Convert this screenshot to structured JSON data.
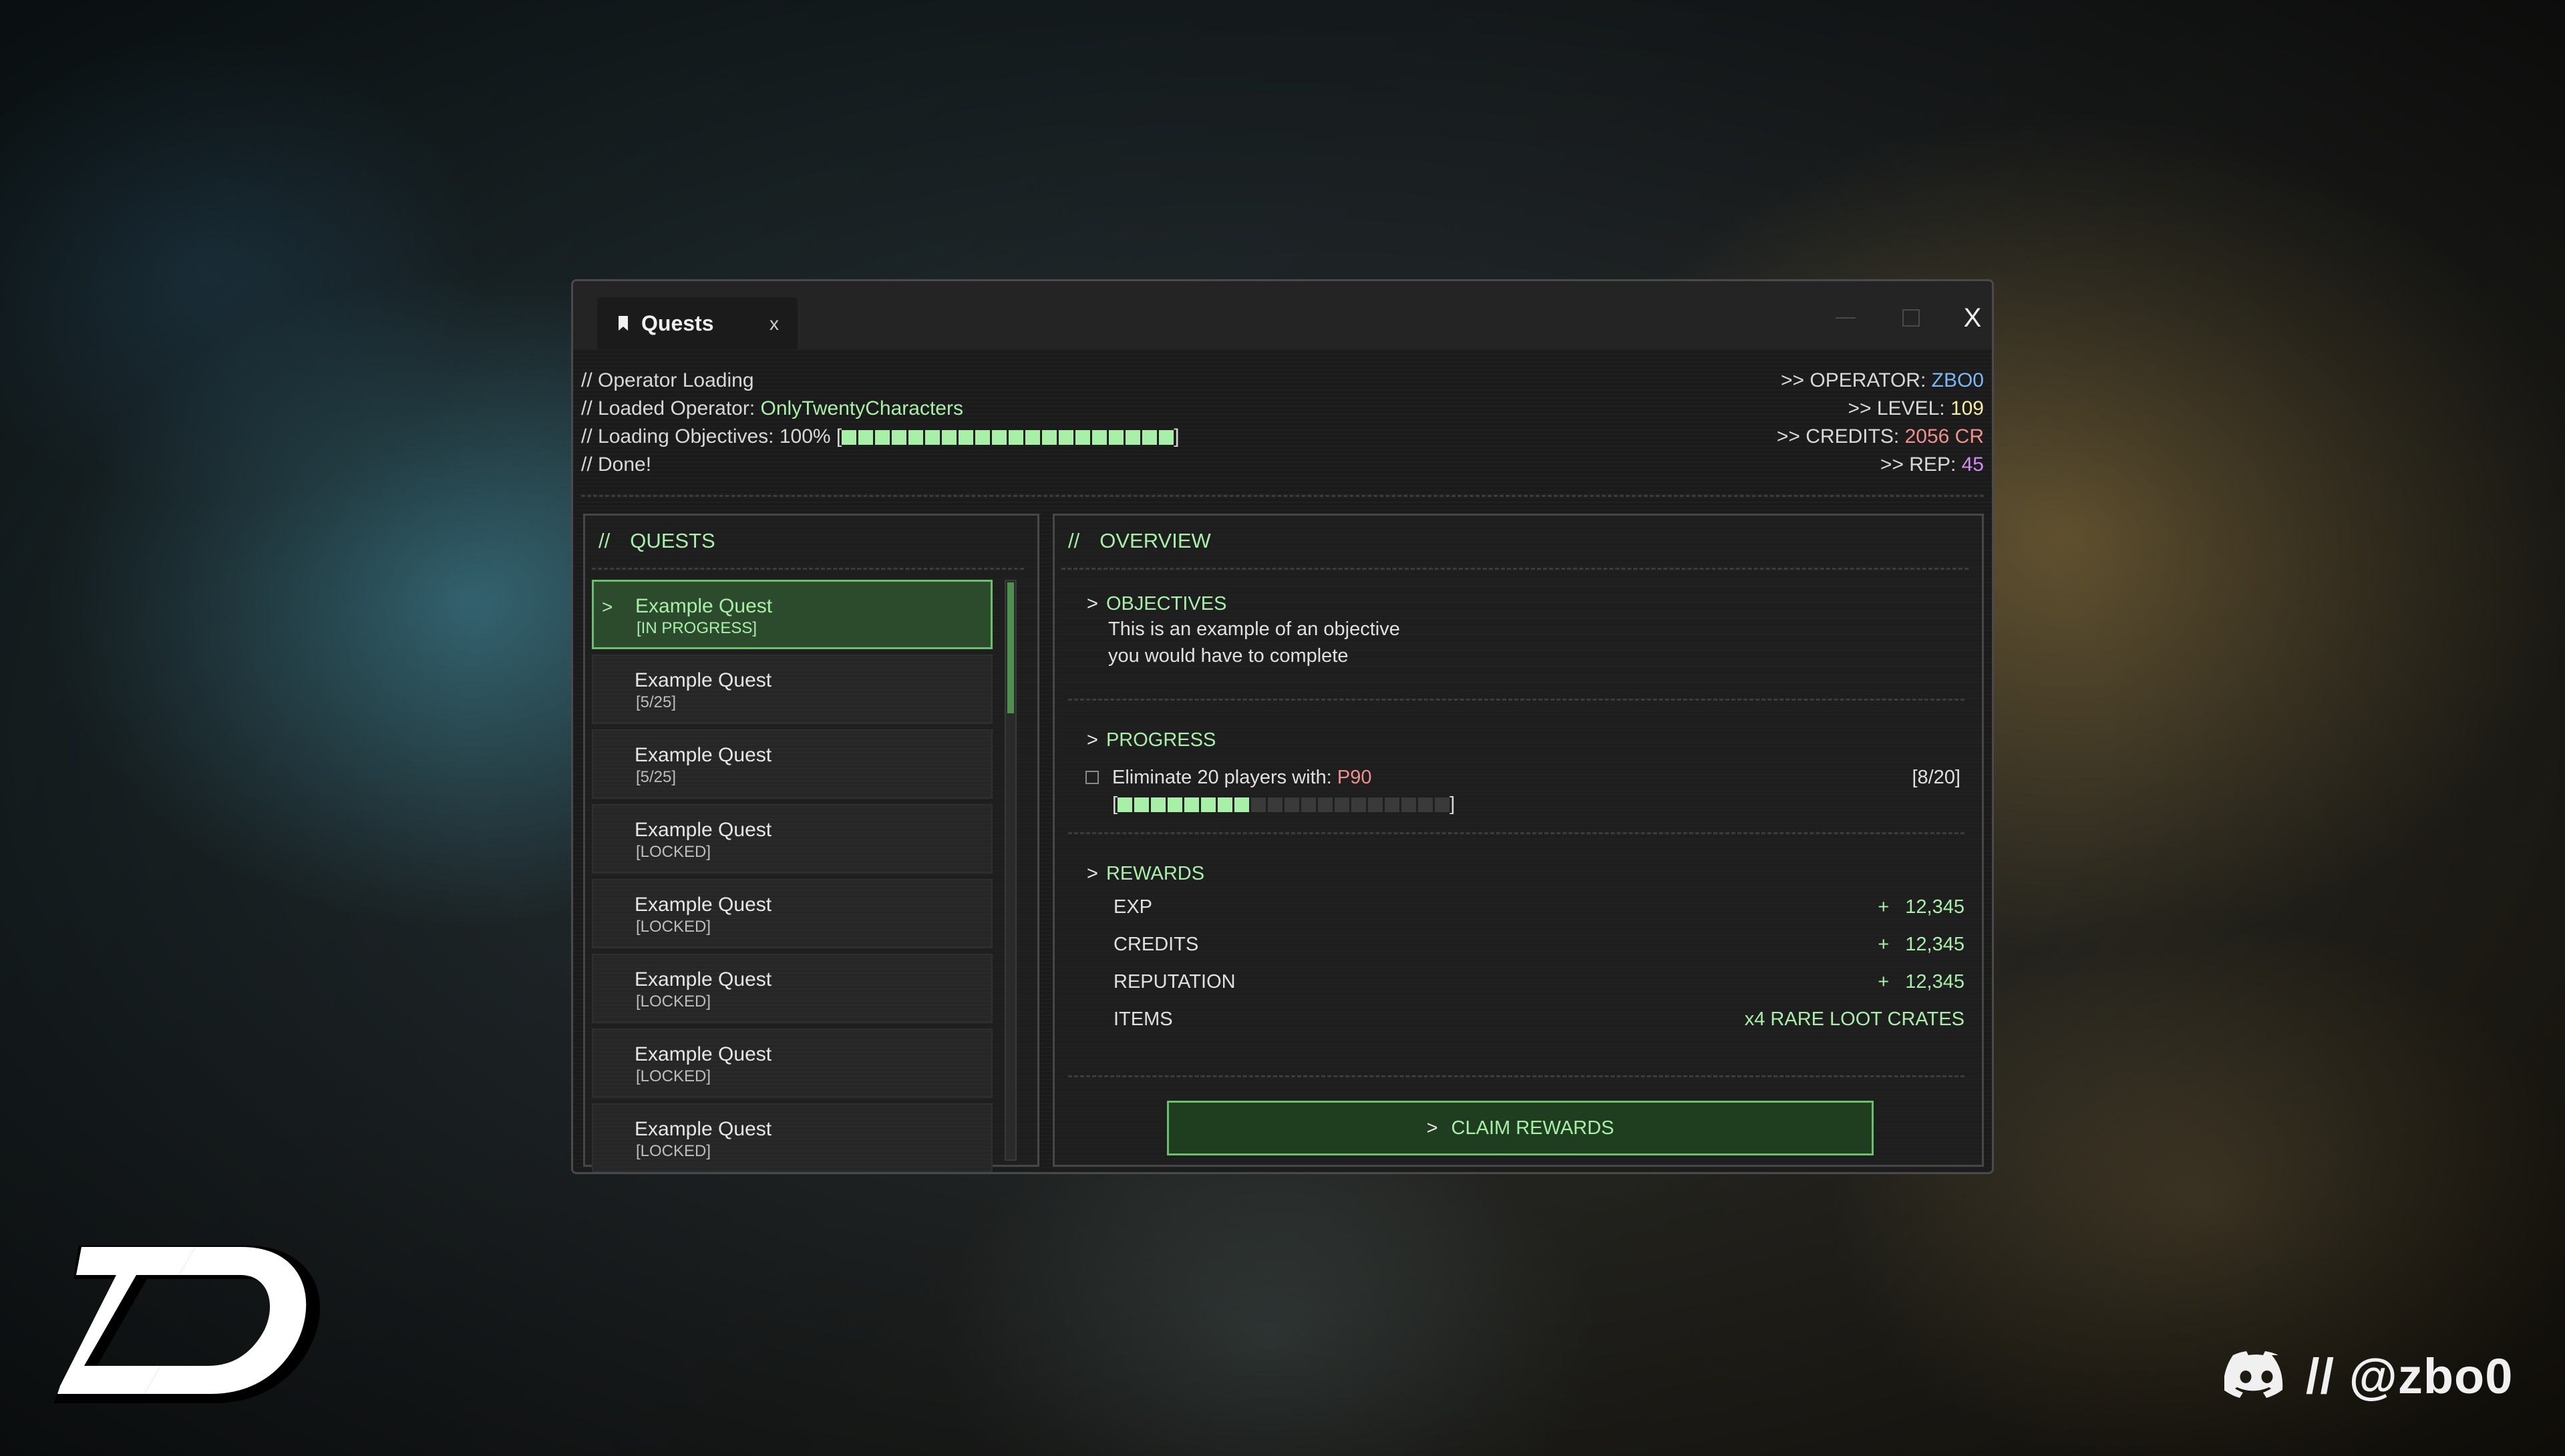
{
  "window": {
    "tab_title": "Quests",
    "tab_close": "x",
    "close_glyph": "X"
  },
  "console": {
    "lines": [
      {
        "prefix": "// Operator Loading",
        "value": ""
      },
      {
        "prefix": "// Loaded Operator: ",
        "value": "OnlyTwentyCharacters"
      },
      {
        "prefix": "// Loading Objectives: 100% [",
        "value": "",
        "suffix": "]"
      },
      {
        "prefix": "// Done!",
        "value": ""
      }
    ],
    "loading_progress": 1.0
  },
  "stats": {
    "operator_label": ">> OPERATOR: ",
    "operator": "ZBO0",
    "level_label": ">> LEVEL: ",
    "level": "109",
    "credits_label": ">> CREDITS: ",
    "credits": "2056 CR",
    "rep_label": ">> REP: ",
    "rep": "45"
  },
  "quests_panel": {
    "slashes": "//",
    "title": "QUESTS",
    "items": [
      {
        "name": "Example Quest",
        "status": "[IN PROGRESS]",
        "active": true
      },
      {
        "name": "Example Quest",
        "status": "[5/25]"
      },
      {
        "name": "Example Quest",
        "status": "[5/25]"
      },
      {
        "name": "Example Quest",
        "status": "[LOCKED]"
      },
      {
        "name": "Example Quest",
        "status": "[LOCKED]"
      },
      {
        "name": "Example Quest",
        "status": "[LOCKED]"
      },
      {
        "name": "Example Quest",
        "status": "[LOCKED]"
      },
      {
        "name": "Example Quest",
        "status": "[LOCKED]"
      }
    ]
  },
  "overview_panel": {
    "slashes": "//",
    "title": "OVERVIEW",
    "objectives": {
      "title": "OBJECTIVES",
      "line1": "This is an example of an objective",
      "line2": "you would have to complete"
    },
    "progress": {
      "title": "PROGRESS",
      "task_label": "Eliminate 20 players with: ",
      "weapon": "P90",
      "count": "[8/20]",
      "bar_open": "[",
      "bar_close": "]",
      "fraction": 0.4
    },
    "rewards": {
      "title": "REWARDS",
      "rows": [
        {
          "label": "EXP",
          "value": "+   12,345"
        },
        {
          "label": "CREDITS",
          "value": "+   12,345"
        },
        {
          "label": "REPUTATION",
          "value": "+   12,345"
        },
        {
          "label": "ITEMS",
          "value": "x4 RARE LOOT CRATES"
        }
      ]
    },
    "claim_label": "CLAIM REWARDS"
  },
  "arrow_glyph": ">",
  "footer": {
    "discord_handle": "// @zbo0"
  },
  "colors": {
    "accent_green": "#a8f0a8",
    "operator_blue": "#7ab8f5",
    "level_yellow": "#f5ee9a",
    "credits_red": "#f0908c",
    "rep_purple": "#d08ef0"
  }
}
